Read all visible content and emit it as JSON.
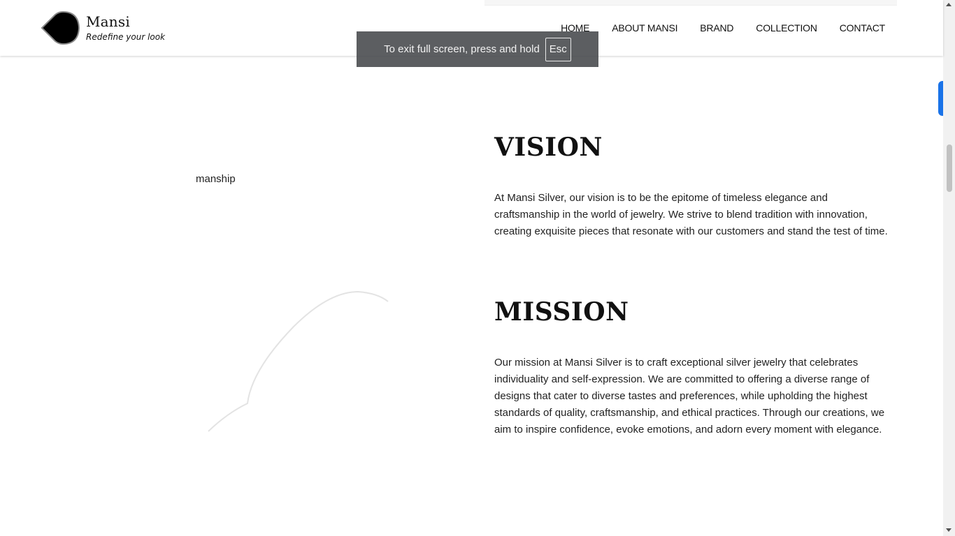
{
  "brand": {
    "name": "Mansi",
    "tagline": "Redefine your look"
  },
  "nav": {
    "items": [
      "HOME",
      "ABOUT MANSI",
      "BRAND",
      "COLLECTION",
      "CONTACT"
    ]
  },
  "fullscreen_notice": {
    "text": "To exit full screen, press and hold",
    "key": "Esc"
  },
  "left_panel": {
    "text_fragment": "manship"
  },
  "vision": {
    "heading": "VISION",
    "body": "At Mansi Silver, our vision is to be the epitome of timeless elegance and craftsmanship in the world of jewelry. We strive to blend tradition with innovation, creating exquisite pieces that resonate with our customers and stand the test of time."
  },
  "mission": {
    "heading": "MISSION",
    "body": "Our mission at Mansi Silver is to craft exceptional silver jewelry that celebrates individuality and self-expression. We are committed to offering a diverse range of designs that cater to diverse tastes and preferences, while upholding the highest standards of quality, craftsmanship, and ethical practices. Through our creations, we aim to inspire confidence, evoke emotions, and adorn every moment with elegance."
  },
  "colors": {
    "accent": "#1a73e8",
    "text": "#222222",
    "toast_bg": "#46484b"
  },
  "icons": {
    "logo": "drop-logo-icon"
  }
}
